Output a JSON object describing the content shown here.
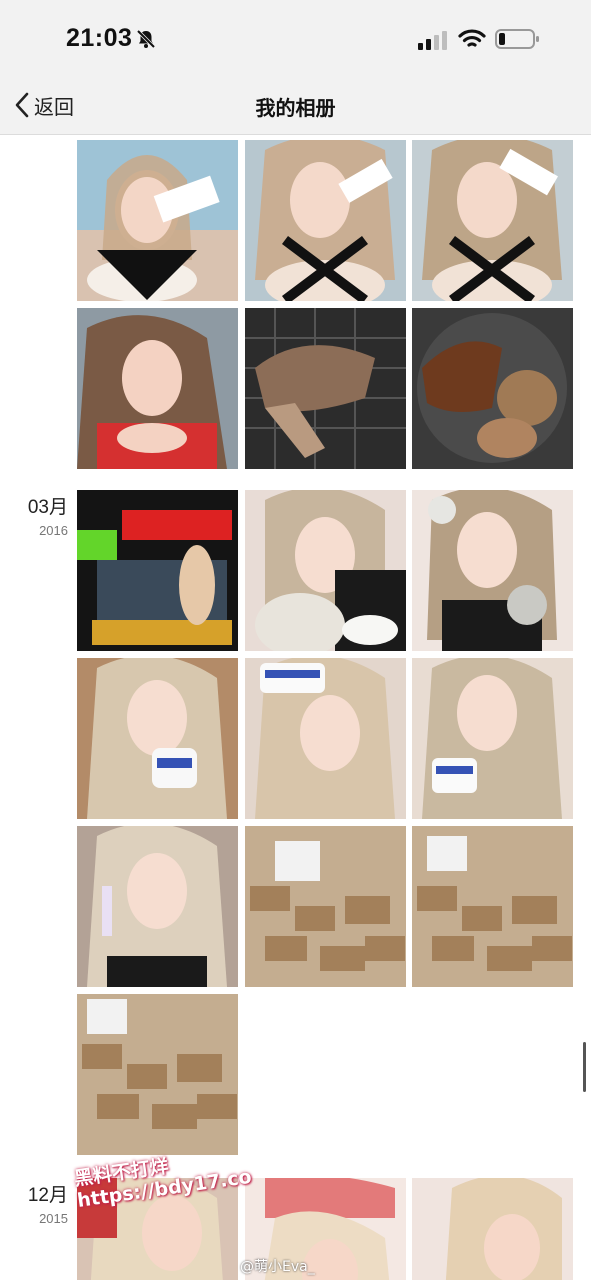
{
  "status_bar": {
    "time": "21:03"
  },
  "nav": {
    "back_label": "返回",
    "title": "我的相册"
  },
  "sections": [
    {
      "month": "03月",
      "year": "2016"
    },
    {
      "month": "12月",
      "year": "2015"
    }
  ],
  "photos": [
    {
      "scene": "selfie-bikini-product"
    },
    {
      "scene": "selfie-bikini-product"
    },
    {
      "scene": "selfie-bikini-product"
    },
    {
      "scene": "selfie-red-lace"
    },
    {
      "scene": "grilled-seafood"
    },
    {
      "scene": "grilled-seafood"
    },
    {
      "scene": "promo-event-poster"
    },
    {
      "scene": "selfie-with-jar"
    },
    {
      "scene": "selfie-with-jar"
    },
    {
      "scene": "selfie-with-jar"
    },
    {
      "scene": "selfie-with-jar"
    },
    {
      "scene": "selfie-with-jar"
    },
    {
      "scene": "selfie-with-tube"
    },
    {
      "scene": "stacked-boxes"
    },
    {
      "scene": "stacked-boxes"
    },
    {
      "scene": "stacked-boxes"
    },
    {
      "scene": "selfie-blonde"
    },
    {
      "scene": "selfie-blonde"
    },
    {
      "scene": "selfie-blonde"
    }
  ],
  "watermarks": {
    "overlay_line1": "黑料不打烊",
    "overlay_line2": "https://bdy17.co",
    "weibo": "@萌小Eva_"
  }
}
